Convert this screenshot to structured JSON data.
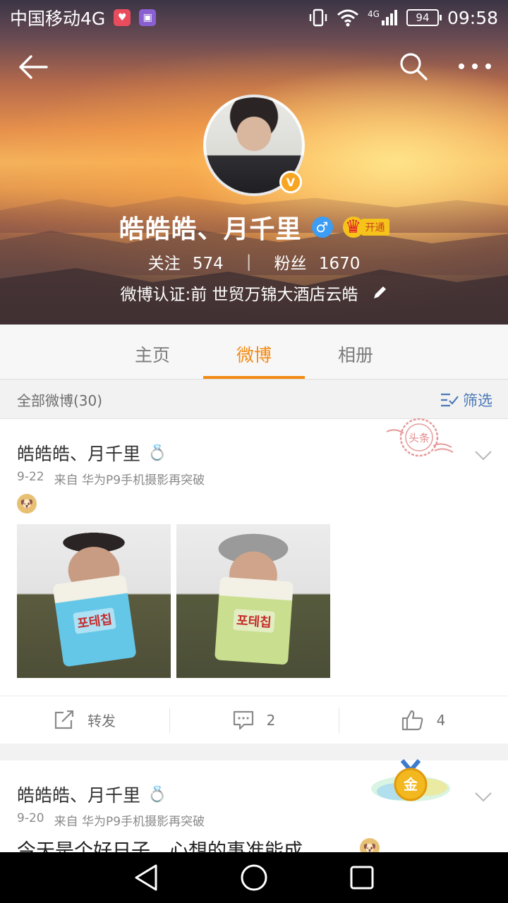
{
  "status_bar": {
    "carrier": "中国移动4G",
    "network": "4G",
    "battery": "94",
    "time": "09:58"
  },
  "profile": {
    "username": "皓皓皓、月千里",
    "vip_label": "开通",
    "verified_mark": "V",
    "follow_label": "关注",
    "follow_count": "574",
    "fans_label": "粉丝",
    "fans_count": "1670",
    "certification": "微博认证:前 世贸万锦大酒店云皓"
  },
  "tabs": [
    {
      "label": "主页",
      "active": false
    },
    {
      "label": "微博",
      "active": true
    },
    {
      "label": "相册",
      "active": false
    }
  ],
  "feed": {
    "count_label": "全部微博(30)",
    "filter_label": "筛选"
  },
  "posts": [
    {
      "author": "皓皓皓、月千里",
      "date": "9-22",
      "source": "来自 华为P9手机摄影再突破",
      "stamp": "头条",
      "bag1_text": "포테칩",
      "bag2_text": "포테칩",
      "actions": {
        "repost": "转发",
        "comments": "2",
        "likes": "4"
      }
    },
    {
      "author": "皓皓皓、月千里",
      "date": "9-20",
      "source": "来自 华为P9手机摄影再突破",
      "medal_label": "金",
      "text": "今天是个好日子，心想的事准能成"
    }
  ],
  "colors": {
    "accent": "#f38b13",
    "link": "#4b79b8",
    "vip_gold": "#f6c31b",
    "verified_orange": "#f6a623",
    "gender_blue": "#3d9cf3"
  }
}
